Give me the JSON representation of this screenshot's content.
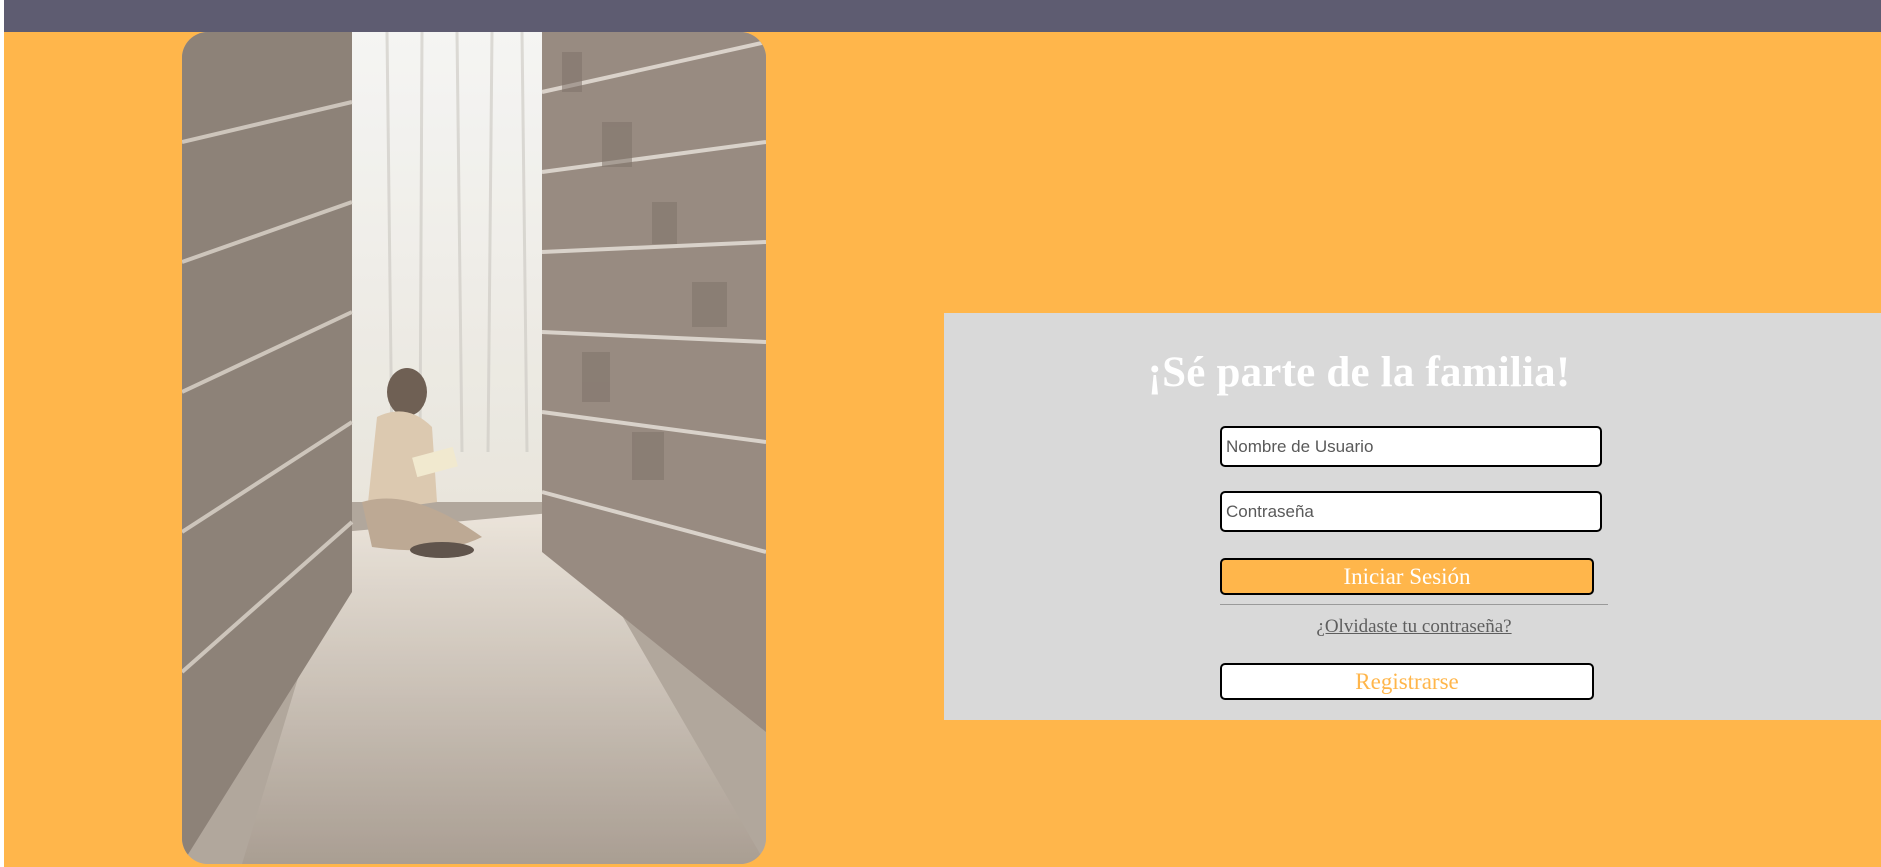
{
  "colors": {
    "background": "#FFB64B",
    "topbar": "#5E5C71",
    "panel": "#D9D9D9",
    "accent": "#FFB64B",
    "heading": "#FFFFFF"
  },
  "hero_image": {
    "icon": "library-reading-photo"
  },
  "login": {
    "heading": "¡Sé parte de la familia!",
    "username_placeholder": "Nombre de Usuario",
    "username_value": "",
    "password_placeholder": "Contraseña",
    "password_value": "",
    "login_label": "Iniciar Sesión",
    "forgot_label": "¿Olvidaste tu contraseña?",
    "register_label": "Registrarse"
  }
}
